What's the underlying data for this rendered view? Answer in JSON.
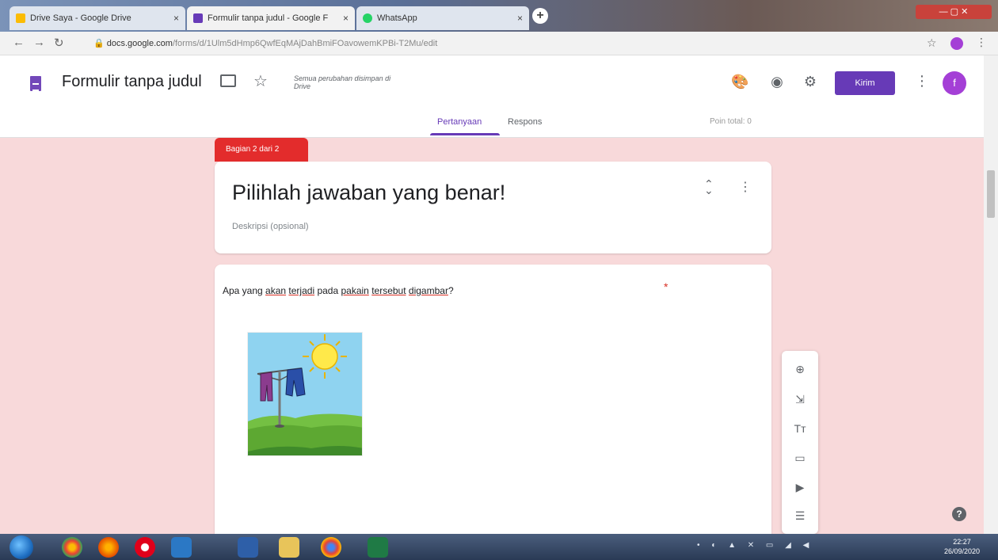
{
  "browser": {
    "tabs": [
      {
        "label": "Drive Saya - Google Drive",
        "active": false,
        "color": "#fbbc04"
      },
      {
        "label": "Formulir tanpa judul - Google F",
        "active": true,
        "color": "#673ab7"
      },
      {
        "label": "WhatsApp",
        "active": false,
        "color": "#25d366"
      }
    ],
    "close_glyph": "×",
    "new_tab_glyph": "+",
    "url_host": "docs.google.com",
    "url_path": "/forms/d/1Ulm5dHmp6QwfEqMAjDahBmiFOavowemKPBi-T2Mu/edit"
  },
  "forms_header": {
    "title": "Formulir tanpa judul",
    "save_status": "Semua perubahan disimpan di Drive",
    "send_label": "Kirim",
    "avatar_initial": "f",
    "tabs": [
      "Pertanyaan",
      "Respons"
    ],
    "points_label": "Poin total: 0"
  },
  "section": {
    "tab_label": "Bagian 2 dari 2",
    "title": "Pilihlah jawaban yang benar!",
    "description_placeholder": "Deskripsi (opsional)"
  },
  "question": {
    "text_parts": [
      "Apa yang ",
      "akan",
      " ",
      "terjadi",
      " pada ",
      "pakain",
      " ",
      "tersebut",
      " ",
      "digambar",
      "?"
    ],
    "required_mark": "*"
  },
  "toolbar_items": [
    {
      "name": "add-question-icon",
      "glyph": "⊕"
    },
    {
      "name": "import-questions-icon",
      "glyph": "⇲"
    },
    {
      "name": "add-title-icon",
      "glyph": "Tт"
    },
    {
      "name": "add-image-icon",
      "glyph": "▭"
    },
    {
      "name": "add-video-icon",
      "glyph": "▶"
    },
    {
      "name": "add-section-icon",
      "glyph": "☰"
    }
  ],
  "taskbar": {
    "clock_time": "22:27",
    "clock_date": "26/09/2020"
  },
  "colors": {
    "accent": "#673ab7",
    "section_red": "#e32c2c",
    "page_bg": "#f8d9da"
  }
}
